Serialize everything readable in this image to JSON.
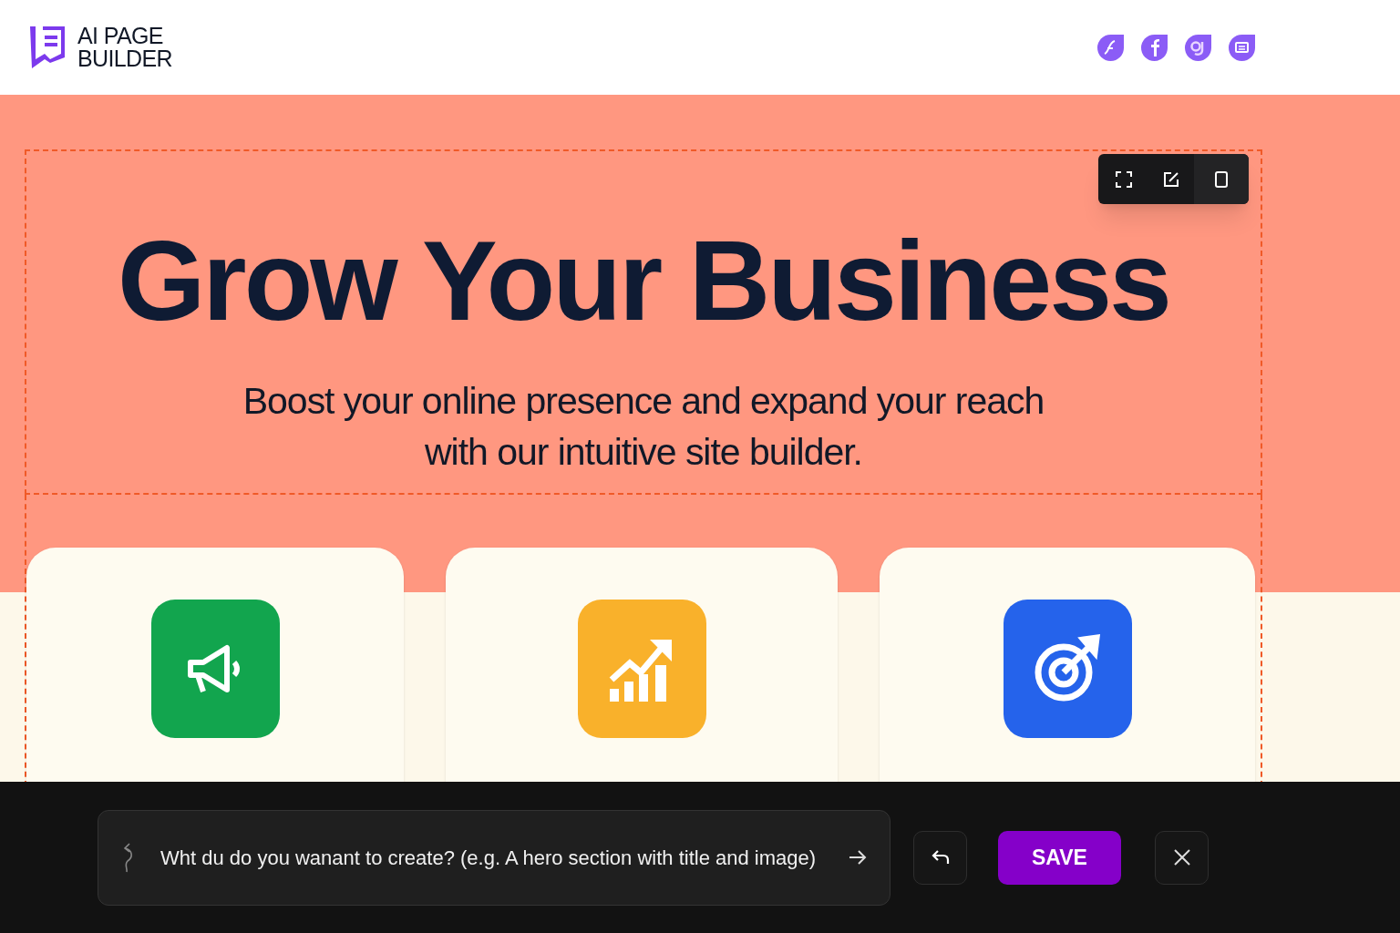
{
  "header": {
    "logo_text": "AI PAGE\nBUILDER"
  },
  "hero": {
    "title": "Grow Your Business",
    "subtitle": "Boost your online presence and expand your reach\nwith our intuitive site builder."
  },
  "cards": [
    {
      "kind": "megaphone",
      "color": "#12a54e"
    },
    {
      "kind": "chart",
      "color": "#f9b12b"
    },
    {
      "kind": "target",
      "color": "#2563eb"
    }
  ],
  "prompt": {
    "placeholder": "Wht du do you wanant to create? (e.g. A hero section with title and image)"
  },
  "save_button": "SAVE"
}
